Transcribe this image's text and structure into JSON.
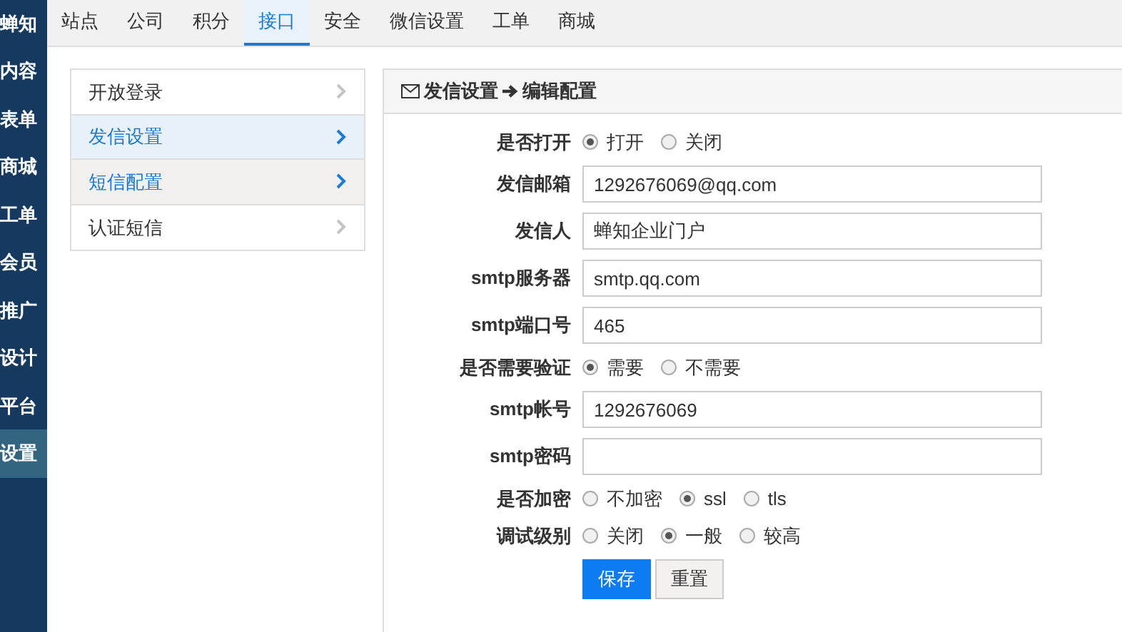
{
  "sidebar": {
    "brand": "蝉知",
    "items": [
      {
        "label": "内容",
        "selected": false
      },
      {
        "label": "表单",
        "selected": false
      },
      {
        "label": "商城",
        "selected": false
      },
      {
        "label": "工单",
        "selected": false
      },
      {
        "label": "会员",
        "selected": false
      },
      {
        "label": "推广",
        "selected": false
      },
      {
        "label": "设计",
        "selected": false
      },
      {
        "label": "平台",
        "selected": false
      },
      {
        "label": "设置",
        "selected": true
      }
    ]
  },
  "tabs": [
    {
      "label": "站点",
      "selected": false
    },
    {
      "label": "公司",
      "selected": false
    },
    {
      "label": "积分",
      "selected": false
    },
    {
      "label": "接口",
      "selected": true
    },
    {
      "label": "安全",
      "selected": false
    },
    {
      "label": "微信设置",
      "selected": false
    },
    {
      "label": "工单",
      "selected": false
    },
    {
      "label": "商城",
      "selected": false
    }
  ],
  "menu": [
    {
      "label": "开放登录",
      "selected": false,
      "hovered": false
    },
    {
      "label": "发信设置",
      "selected": true,
      "hovered": false
    },
    {
      "label": "短信配置",
      "selected": false,
      "hovered": true
    },
    {
      "label": "认证短信",
      "selected": false,
      "hovered": false
    }
  ],
  "panel": {
    "breadcrumb": "发信设置",
    "current": "编辑配置"
  },
  "form": [
    {
      "kind": "radio",
      "label": "是否打开",
      "options": [
        {
          "label": "打开",
          "selected": true
        },
        {
          "label": "关闭",
          "selected": false
        }
      ]
    },
    {
      "kind": "input",
      "label": "发信邮箱",
      "value": "1292676069@qq.com"
    },
    {
      "kind": "input",
      "label": "发信人",
      "value": "蝉知企业门户"
    },
    {
      "kind": "input",
      "label": "smtp服务器",
      "value": "smtp.qq.com"
    },
    {
      "kind": "input",
      "label": "smtp端口号",
      "value": "465"
    },
    {
      "kind": "radio",
      "label": "是否需要验证",
      "options": [
        {
          "label": "需要",
          "selected": true
        },
        {
          "label": "不需要",
          "selected": false
        }
      ]
    },
    {
      "kind": "input",
      "label": "smtp帐号",
      "value": "1292676069"
    },
    {
      "kind": "input",
      "label": "smtp密码"
    },
    {
      "kind": "radio",
      "label": "是否加密",
      "options": [
        {
          "label": "不加密",
          "selected": false
        },
        {
          "label": "ssl",
          "selected": true
        },
        {
          "label": "tls",
          "selected": false
        }
      ]
    },
    {
      "kind": "radio",
      "label": "调试级别",
      "options": [
        {
          "label": "关闭",
          "selected": false
        },
        {
          "label": "一般",
          "selected": true
        },
        {
          "label": "较高",
          "selected": false
        }
      ]
    }
  ],
  "buttons": {
    "save": "保存",
    "reset": "重置"
  }
}
